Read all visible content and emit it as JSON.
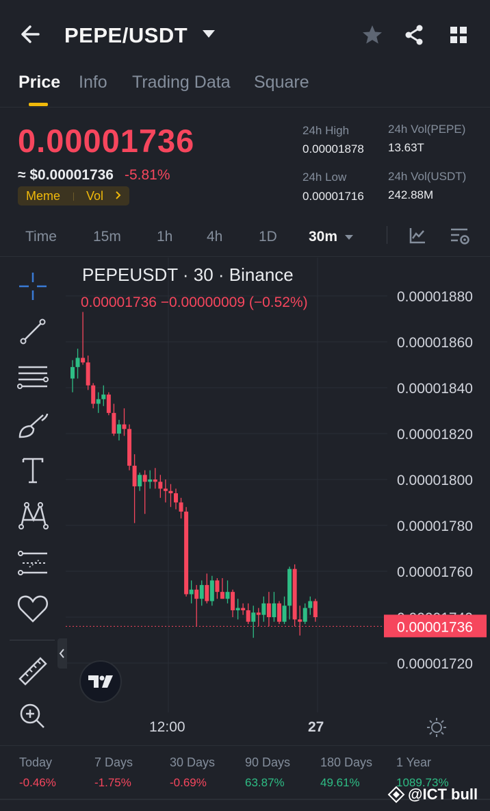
{
  "header": {
    "pair": "PEPE/USDT"
  },
  "tabs": [
    {
      "label": "Price",
      "active": true
    },
    {
      "label": "Info",
      "active": false
    },
    {
      "label": "Trading Data",
      "active": false
    },
    {
      "label": "Square",
      "active": false
    }
  ],
  "ticker": {
    "last_price": "0.00001736",
    "usd_price": "≈ $0.00001736",
    "change_pct": "-5.81%",
    "tags": [
      "Meme",
      "Vol"
    ],
    "stats": {
      "high_label": "24h High",
      "high_value": "0.00001878",
      "low_label": "24h Low",
      "low_value": "0.00001716",
      "vol_base_label": "24h Vol(PEPE)",
      "vol_base_value": "13.63T",
      "vol_quote_label": "24h Vol(USDT)",
      "vol_quote_value": "242.88M"
    }
  },
  "intervals": {
    "items": [
      "Time",
      "15m",
      "1h",
      "4h",
      "1D",
      "30m"
    ],
    "selected": "30m"
  },
  "chart": {
    "legend": "PEPEUSDT · 30 · Binance",
    "ohlc": "0.00001736  −0.00000009 (−0.52%)",
    "current_price_label": "0.00001736",
    "time_labels": [
      "12:00",
      "27"
    ]
  },
  "chart_data": {
    "type": "candlestick",
    "y_axis_labels": [
      "0.00001880",
      "0.00001860",
      "0.00001840",
      "0.00001820",
      "0.00001800",
      "0.00001780",
      "0.00001760",
      "0.00001740",
      "0.00001720"
    ],
    "ylim": [
      1.71e-05,
      1.89e-05
    ],
    "current_price": 1.736e-05,
    "up_color": "#2ebd85",
    "down_color": "#f6465d",
    "candles": [
      {
        "o": 18440,
        "h": 18520,
        "l": 18380,
        "c": 18490
      },
      {
        "o": 18490,
        "h": 18570,
        "l": 18440,
        "c": 18530
      },
      {
        "o": 18530,
        "h": 18730,
        "l": 18500,
        "c": 18510
      },
      {
        "o": 18510,
        "h": 18540,
        "l": 18390,
        "c": 18410
      },
      {
        "o": 18410,
        "h": 18420,
        "l": 18310,
        "c": 18330
      },
      {
        "o": 18330,
        "h": 18380,
        "l": 18290,
        "c": 18350
      },
      {
        "o": 18350,
        "h": 18410,
        "l": 18320,
        "c": 18370
      },
      {
        "o": 18370,
        "h": 18380,
        "l": 18280,
        "c": 18290
      },
      {
        "o": 18290,
        "h": 18330,
        "l": 18190,
        "c": 18200
      },
      {
        "o": 18200,
        "h": 18260,
        "l": 18170,
        "c": 18240
      },
      {
        "o": 18240,
        "h": 18310,
        "l": 18190,
        "c": 18220
      },
      {
        "o": 18220,
        "h": 18240,
        "l": 18040,
        "c": 18060
      },
      {
        "o": 18060,
        "h": 18110,
        "l": 17810,
        "c": 17970
      },
      {
        "o": 17970,
        "h": 18030,
        "l": 17950,
        "c": 18020
      },
      {
        "o": 18020,
        "h": 18040,
        "l": 17850,
        "c": 17990
      },
      {
        "o": 17990,
        "h": 18040,
        "l": 17960,
        "c": 18000
      },
      {
        "o": 18000,
        "h": 18050,
        "l": 17960,
        "c": 17990
      },
      {
        "o": 17990,
        "h": 18020,
        "l": 17920,
        "c": 17960
      },
      {
        "o": 17960,
        "h": 18000,
        "l": 17900,
        "c": 17950
      },
      {
        "o": 17950,
        "h": 17980,
        "l": 17880,
        "c": 17940
      },
      {
        "o": 17940,
        "h": 17960,
        "l": 17870,
        "c": 17900
      },
      {
        "o": 17900,
        "h": 17920,
        "l": 17830,
        "c": 17860
      },
      {
        "o": 17860,
        "h": 17880,
        "l": 17490,
        "c": 17500
      },
      {
        "o": 17500,
        "h": 17560,
        "l": 17460,
        "c": 17520
      },
      {
        "o": 17520,
        "h": 17540,
        "l": 17360,
        "c": 17480
      },
      {
        "o": 17480,
        "h": 17560,
        "l": 17450,
        "c": 17540
      },
      {
        "o": 17540,
        "h": 17590,
        "l": 17460,
        "c": 17470
      },
      {
        "o": 17470,
        "h": 17580,
        "l": 17450,
        "c": 17560
      },
      {
        "o": 17560,
        "h": 17570,
        "l": 17480,
        "c": 17510
      },
      {
        "o": 17510,
        "h": 17570,
        "l": 17480,
        "c": 17480
      },
      {
        "o": 17480,
        "h": 17560,
        "l": 17460,
        "c": 17510
      },
      {
        "o": 17510,
        "h": 17520,
        "l": 17400,
        "c": 17430
      },
      {
        "o": 17430,
        "h": 17480,
        "l": 17390,
        "c": 17440
      },
      {
        "o": 17440,
        "h": 17460,
        "l": 17410,
        "c": 17430
      },
      {
        "o": 17430,
        "h": 17460,
        "l": 17370,
        "c": 17380
      },
      {
        "o": 17380,
        "h": 17450,
        "l": 17310,
        "c": 17420
      },
      {
        "o": 17420,
        "h": 17440,
        "l": 17360,
        "c": 17410
      },
      {
        "o": 17410,
        "h": 17490,
        "l": 17380,
        "c": 17460
      },
      {
        "o": 17460,
        "h": 17510,
        "l": 17360,
        "c": 17400
      },
      {
        "o": 17400,
        "h": 17510,
        "l": 17380,
        "c": 17460
      },
      {
        "o": 17460,
        "h": 17470,
        "l": 17370,
        "c": 17380
      },
      {
        "o": 17380,
        "h": 17490,
        "l": 17370,
        "c": 17450
      },
      {
        "o": 17450,
        "h": 17620,
        "l": 17390,
        "c": 17610
      },
      {
        "o": 17610,
        "h": 17630,
        "l": 17360,
        "c": 17390
      },
      {
        "o": 17390,
        "h": 17450,
        "l": 17320,
        "c": 17380
      },
      {
        "o": 17380,
        "h": 17460,
        "l": 17370,
        "c": 17440
      },
      {
        "o": 17440,
        "h": 17490,
        "l": 17410,
        "c": 17470
      },
      {
        "o": 17470,
        "h": 17480,
        "l": 17380,
        "c": 17400
      }
    ]
  },
  "performance": [
    {
      "label": "Today",
      "value": "-0.46%",
      "trend": "neg"
    },
    {
      "label": "7 Days",
      "value": "-1.75%",
      "trend": "neg"
    },
    {
      "label": "30 Days",
      "value": "-0.69%",
      "trend": "neg"
    },
    {
      "label": "90 Days",
      "value": "63.87%",
      "trend": "pos"
    },
    {
      "label": "180 Days",
      "value": "49.61%",
      "trend": "pos"
    },
    {
      "label": "1 Year",
      "value": "1089.73%",
      "trend": "pos"
    }
  ],
  "watermark": "@ICT bull",
  "colors": {
    "accent": "#f0b90b",
    "down": "#f6465d",
    "up": "#2ebd85"
  }
}
